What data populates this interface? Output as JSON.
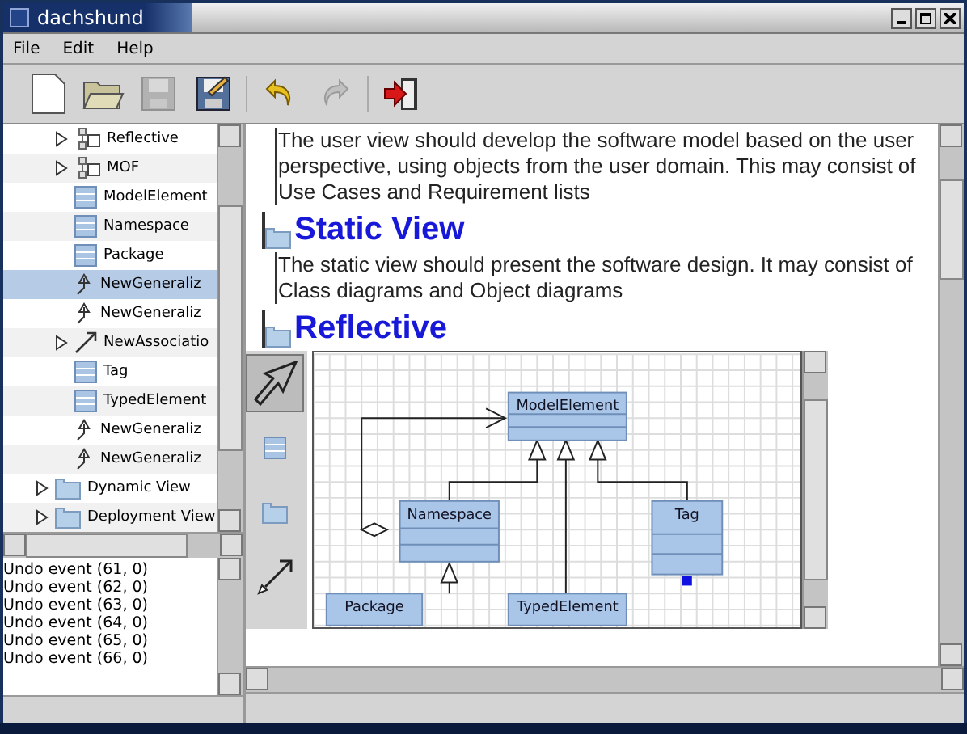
{
  "window": {
    "title": "dachshund"
  },
  "menu": [
    "File",
    "Edit",
    "Help"
  ],
  "toolbar": [
    {
      "kind": "new",
      "disabled": false
    },
    {
      "kind": "open",
      "disabled": false
    },
    {
      "kind": "save",
      "disabled": true
    },
    {
      "kind": "edit",
      "disabled": false
    },
    {
      "kind": "undo",
      "disabled": false
    },
    {
      "kind": "redo",
      "disabled": true
    },
    {
      "kind": "exit",
      "disabled": false
    }
  ],
  "tree": {
    "visible_children": [
      {
        "label": "Reflective",
        "kind": "package",
        "expandable": true,
        "selected": false
      },
      {
        "label": "MOF",
        "kind": "package",
        "expandable": true,
        "selected": false
      },
      {
        "label": "ModelElement",
        "kind": "class",
        "expandable": false,
        "selected": false
      },
      {
        "label": "Namespace",
        "kind": "class",
        "expandable": false,
        "selected": false
      },
      {
        "label": "Package",
        "kind": "class",
        "expandable": false,
        "selected": false
      },
      {
        "label": "NewGeneraliz",
        "kind": "generalization",
        "expandable": false,
        "selected": true
      },
      {
        "label": "NewGeneraliz",
        "kind": "generalization",
        "expandable": false,
        "selected": false
      },
      {
        "label": "NewAssociatio",
        "kind": "association",
        "expandable": true,
        "selected": false
      },
      {
        "label": "Tag",
        "kind": "class",
        "expandable": false,
        "selected": false
      },
      {
        "label": "TypedElement",
        "kind": "class",
        "expandable": false,
        "selected": false
      },
      {
        "label": "NewGeneraliz",
        "kind": "generalization",
        "expandable": false,
        "selected": false
      },
      {
        "label": "NewGeneraliz",
        "kind": "generalization",
        "expandable": false,
        "selected": false
      }
    ],
    "top_items": [
      {
        "label": "Dynamic View",
        "kind": "folder",
        "expandable": true,
        "selected": false
      },
      {
        "label": "Deployment View",
        "kind": "folder",
        "expandable": true,
        "selected": false
      }
    ]
  },
  "log": [
    "Undo event (61, 0)",
    "Undo event (62, 0)",
    "Undo event (63, 0)",
    "Undo event (64, 0)",
    "Undo event (65, 0)",
    "Undo event (66, 0)"
  ],
  "document": [
    {
      "kind": "paragraph",
      "text": "The user view should develop the software model based on the user perspective, using objects from the user domain.  This may consist of Use Cases and Requirement lists"
    },
    {
      "kind": "heading",
      "text": "Static View"
    },
    {
      "kind": "paragraph",
      "text": "The static view should present the software design.  It may consist of Class diagrams and Object diagrams"
    },
    {
      "kind": "heading",
      "text": "Reflective"
    },
    {
      "kind": "diagram"
    }
  ],
  "diagram": {
    "palette": [
      {
        "kind": "select",
        "selected": true
      },
      {
        "kind": "class",
        "selected": false
      },
      {
        "kind": "package",
        "selected": false
      },
      {
        "kind": "association",
        "selected": false
      }
    ],
    "nodes": [
      {
        "name": "ModelElement"
      },
      {
        "name": "Namespace"
      },
      {
        "name": "Tag"
      },
      {
        "name": "Package"
      },
      {
        "name": "TypedElement"
      }
    ]
  }
}
